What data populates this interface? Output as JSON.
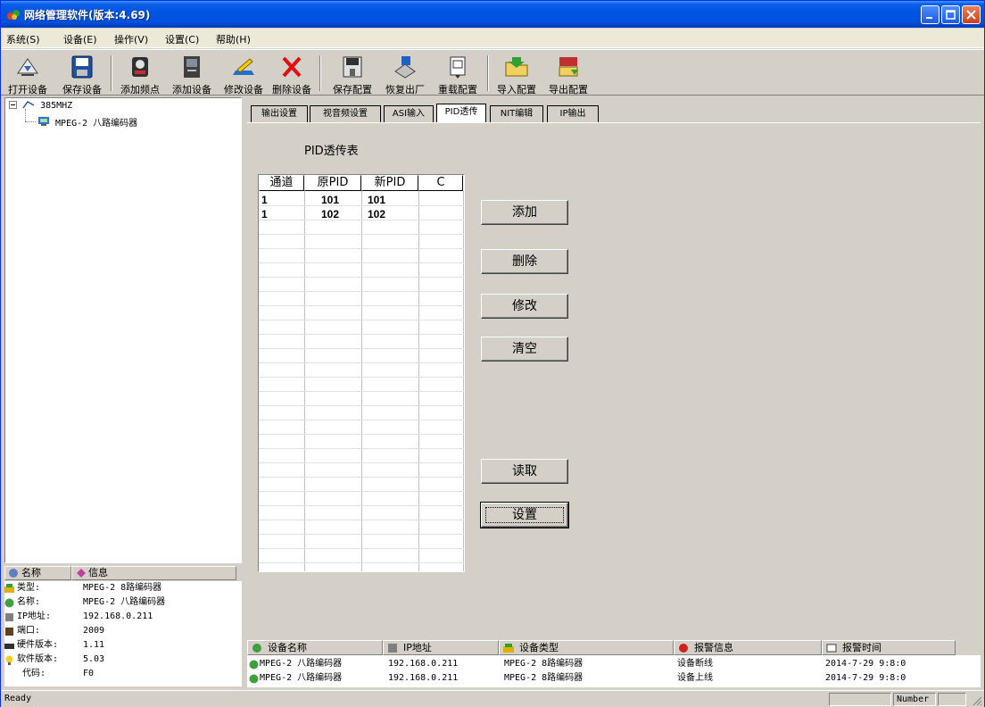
{
  "window": {
    "title": "网络管理软件(版本:4.69)"
  },
  "menu": [
    "系统(S)",
    "设备(E)",
    "操作(V)",
    "设置(C)",
    "帮助(H)"
  ],
  "toolbar": {
    "open_device": "打开设备",
    "save_device": "保存设备",
    "add_freq": "添加频点",
    "add_device": "添加设备",
    "modify_device": "修改设备",
    "delete_device": "删除设备",
    "save_config": "保存配置",
    "factory_reset": "恢复出厂",
    "reload_config": "重载配置",
    "import_config": "导入配置",
    "export_config": "导出配置"
  },
  "tree": {
    "root": "385MHZ",
    "child": "MPEG-2 八路编码器"
  },
  "info": {
    "col_name": "名称",
    "col_info": "信息",
    "rows": [
      {
        "key": "类型:",
        "value": "MPEG-2 8路编码器"
      },
      {
        "key": "名称:",
        "value": "MPEG-2 八路编码器"
      },
      {
        "key": "IP地址:",
        "value": "192.168.0.211"
      },
      {
        "key": "端口:",
        "value": "2009"
      },
      {
        "key": "硬件版本:",
        "value": "1.11"
      },
      {
        "key": "软件版本:",
        "value": "5.03"
      },
      {
        "key": "代码:",
        "value": "F0"
      }
    ]
  },
  "tabs": [
    "输出设置",
    "视音频设置",
    "ASI输入",
    "PID透传",
    "NIT编辑",
    "IP输出"
  ],
  "active_tab": "PID透传",
  "pid": {
    "title": "PID透传表",
    "columns": [
      "通道",
      "原PID",
      "新PID",
      "C"
    ],
    "rows": [
      [
        "1",
        "101",
        "101",
        ""
      ],
      [
        "1",
        "102",
        "102",
        ""
      ]
    ],
    "buttons": {
      "add": "添加",
      "delete": "删除",
      "modify": "修改",
      "clear": "清空",
      "read": "读取",
      "set": "设置"
    }
  },
  "log": {
    "columns": [
      "设备名称",
      "IP地址",
      "设备类型",
      "报警信息",
      "报警时间"
    ],
    "rows": [
      [
        "MPEG-2 八路编码器",
        "192.168.0.211",
        "MPEG-2 8路编码器",
        "设备断线",
        "2014-7-29 9:8:0"
      ],
      [
        "MPEG-2 八路编码器",
        "192.168.0.211",
        "MPEG-2 8路编码器",
        "设备上线",
        "2014-7-29 9:8:0"
      ]
    ]
  },
  "status": {
    "text": "Ready",
    "mode": "Number"
  },
  "colors": {
    "title_bar": "#0054e3",
    "face": "#d4d0c8"
  }
}
